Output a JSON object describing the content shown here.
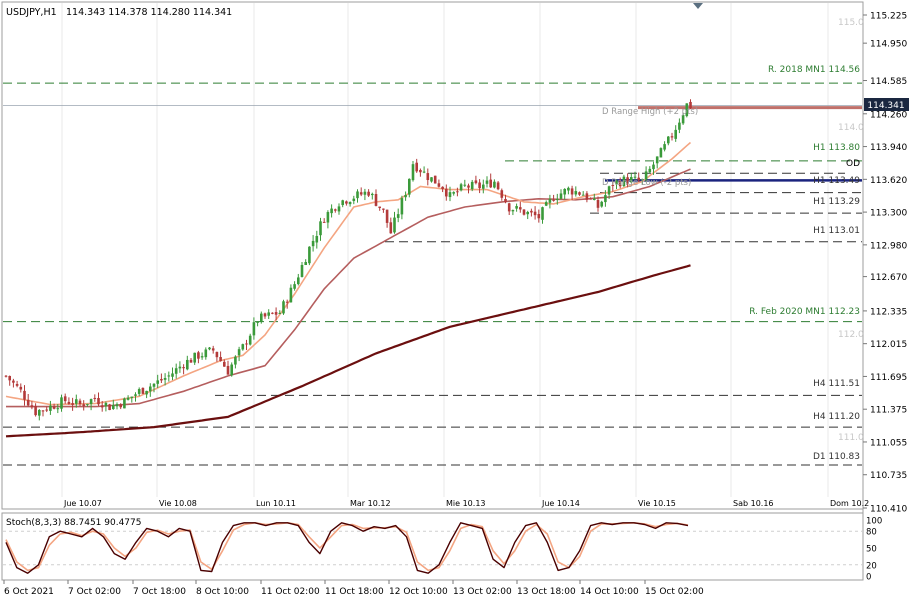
{
  "header": {
    "symbol": "USDJPY,H1",
    "ohlc": "114.343 114.378 114.280 114.341"
  },
  "price_tag": "114.341",
  "stoch_label": "Stoch(8,3,3) 88.7451 90.4775",
  "annotations": {
    "r2018": "R. 2018 MN1 114.56",
    "h1_113_80": "H1 113.80",
    "od": "OD",
    "h1_113_49": "H1 113.49",
    "h1_113_29": "H1 113.29",
    "h1_113_01": "H1 113.01",
    "rfeb2020": "R. Feb 2020 MN1 112.23",
    "h4_111_51": "H4 111.51",
    "h4_111_20": "H4 111.20",
    "d1_110_83": "D1 110.83",
    "drange_high": "D Range High (+2 pts)",
    "drange_low": "D Range Low (-2 pts)",
    "wm_115": "115.0",
    "wm_114": "114.0",
    "wm_112": "112.0",
    "wm_111": "111.0"
  },
  "colors": {
    "ma_fast": "#f4a582",
    "ma_mid": "#b55e5e",
    "ma_slow": "#6b0f0f",
    "bull": "#3a9a3a",
    "bear": "#b33a3a",
    "stoch_main": "#4a0000",
    "stoch_signal": "#f4a582",
    "level_green": "#2e7d32",
    "level_blue": "#1a237e",
    "level_red": "#c0706a"
  },
  "chart_data": {
    "type": "candlestick",
    "y_ticks": [
      "115.225",
      "114.950",
      "114.585",
      "114.260",
      "113.940",
      "113.620",
      "113.300",
      "112.980",
      "112.670",
      "112.335",
      "112.015",
      "111.695",
      "111.375",
      "111.055",
      "110.735",
      "110.410"
    ],
    "x_ticks_top": [
      "Jue 10.07",
      "Vie 10.08",
      "Lun 10.11",
      "Mar 10.12",
      "Mie 10.13",
      "Jue 10.14",
      "Vie 10.15",
      "Sab 10.16",
      "Dom 10.2"
    ],
    "x_ticks_bottom": [
      "6 Oct 2021",
      "7 Oct 02:00",
      "7 Oct 18:00",
      "8 Oct 10:00",
      "11 Oct 02:00",
      "11 Oct 18:00",
      "12 Oct 10:00",
      "13 Oct 02:00",
      "13 Oct 18:00",
      "14 Oct 10:00",
      "15 Oct 02:00"
    ],
    "stoch_ticks": [
      "100",
      "80",
      "50",
      "20",
      "0"
    ],
    "close_path": [
      [
        0,
        111.7
      ],
      [
        4,
        111.55
      ],
      [
        8,
        111.35
      ],
      [
        12,
        111.4
      ],
      [
        16,
        111.46
      ],
      [
        20,
        111.42
      ],
      [
        24,
        111.48
      ],
      [
        28,
        111.4
      ],
      [
        32,
        111.45
      ],
      [
        36,
        111.55
      ],
      [
        40,
        111.62
      ],
      [
        44,
        111.7
      ],
      [
        48,
        111.82
      ],
      [
        52,
        111.9
      ],
      [
        56,
        111.95
      ],
      [
        60,
        111.75
      ],
      [
        64,
        111.98
      ],
      [
        68,
        112.25
      ],
      [
        72,
        112.3
      ],
      [
        74,
        112.32
      ],
      [
        78,
        112.6
      ],
      [
        82,
        112.95
      ],
      [
        86,
        113.25
      ],
      [
        90,
        113.4
      ],
      [
        94,
        113.45
      ],
      [
        98,
        113.5
      ],
      [
        102,
        113.3
      ],
      [
        104,
        113.1
      ],
      [
        108,
        113.5
      ],
      [
        110,
        113.78
      ],
      [
        114,
        113.65
      ],
      [
        118,
        113.55
      ],
      [
        120,
        113.45
      ],
      [
        124,
        113.55
      ],
      [
        128,
        113.55
      ],
      [
        132,
        113.6
      ],
      [
        136,
        113.35
      ],
      [
        140,
        113.3
      ],
      [
        144,
        113.25
      ],
      [
        148,
        113.45
      ],
      [
        152,
        113.52
      ],
      [
        156,
        113.48
      ],
      [
        160,
        113.35
      ],
      [
        164,
        113.58
      ],
      [
        168,
        113.62
      ],
      [
        172,
        113.6
      ],
      [
        176,
        113.82
      ],
      [
        180,
        114.05
      ],
      [
        184,
        114.35
      ],
      [
        185,
        114.34
      ]
    ],
    "ma_fast_path": [
      [
        0,
        111.5
      ],
      [
        12,
        111.42
      ],
      [
        24,
        111.43
      ],
      [
        36,
        111.5
      ],
      [
        48,
        111.7
      ],
      [
        58,
        111.85
      ],
      [
        64,
        111.9
      ],
      [
        70,
        112.1
      ],
      [
        78,
        112.5
      ],
      [
        86,
        112.95
      ],
      [
        94,
        113.35
      ],
      [
        100,
        113.4
      ],
      [
        106,
        113.42
      ],
      [
        112,
        113.55
      ],
      [
        120,
        113.52
      ],
      [
        130,
        113.52
      ],
      [
        140,
        113.4
      ],
      [
        148,
        113.38
      ],
      [
        156,
        113.45
      ],
      [
        164,
        113.5
      ],
      [
        172,
        113.6
      ],
      [
        180,
        113.82
      ],
      [
        185,
        113.98
      ]
    ],
    "ma_mid_path": [
      [
        0,
        111.4
      ],
      [
        12,
        111.4
      ],
      [
        24,
        111.4
      ],
      [
        36,
        111.43
      ],
      [
        48,
        111.55
      ],
      [
        60,
        111.7
      ],
      [
        70,
        111.8
      ],
      [
        78,
        112.15
      ],
      [
        86,
        112.55
      ],
      [
        94,
        112.85
      ],
      [
        104,
        113.05
      ],
      [
        114,
        113.25
      ],
      [
        124,
        113.35
      ],
      [
        134,
        113.4
      ],
      [
        144,
        113.43
      ],
      [
        154,
        113.42
      ],
      [
        164,
        113.45
      ],
      [
        174,
        113.55
      ],
      [
        185,
        113.72
      ]
    ],
    "ma_slow_path": [
      [
        0,
        111.11
      ],
      [
        20,
        111.15
      ],
      [
        40,
        111.2
      ],
      [
        60,
        111.3
      ],
      [
        80,
        111.6
      ],
      [
        100,
        111.92
      ],
      [
        120,
        112.18
      ],
      [
        140,
        112.35
      ],
      [
        160,
        112.52
      ],
      [
        175,
        112.68
      ],
      [
        185,
        112.78
      ]
    ],
    "levels": [
      {
        "price": 114.56,
        "style": "green-dash",
        "label": "r2018"
      },
      {
        "price": 113.8,
        "style": "green-dash",
        "label": "h1_113_80"
      },
      {
        "price": 113.49,
        "style": "dark-dash",
        "label": "h1_113_49"
      },
      {
        "price": 113.29,
        "style": "dark-dash",
        "label": "h1_113_29"
      },
      {
        "price": 113.01,
        "style": "dark-dash",
        "label": "h1_113_01"
      },
      {
        "price": 112.23,
        "style": "green-dash",
        "label": "rfeb2020"
      },
      {
        "price": 111.51,
        "style": "dark-dash",
        "label": "h4_111_51"
      },
      {
        "price": 111.2,
        "style": "dark-dash",
        "label": "h4_111_20"
      },
      {
        "price": 110.83,
        "style": "dark-dash",
        "label": "d1_110_83"
      }
    ],
    "current_price": 114.341,
    "drange_high": 114.32,
    "drange_low": 113.61,
    "stoch_main": [
      60,
      15,
      5,
      20,
      70,
      80,
      75,
      70,
      85,
      70,
      40,
      30,
      60,
      85,
      80,
      70,
      85,
      80,
      10,
      8,
      60,
      90,
      95,
      95,
      90,
      95,
      95,
      90,
      60,
      40,
      80,
      95,
      90,
      80,
      88,
      85,
      90,
      70,
      10,
      5,
      20,
      60,
      95,
      90,
      85,
      30,
      15,
      60,
      90,
      95,
      60,
      10,
      15,
      45,
      90,
      95,
      92,
      95,
      95,
      92,
      85,
      95,
      94,
      90
    ],
    "stoch_signal": [
      65,
      25,
      10,
      15,
      55,
      75,
      78,
      72,
      80,
      75,
      50,
      35,
      50,
      78,
      82,
      75,
      80,
      82,
      25,
      12,
      45,
      82,
      92,
      95,
      92,
      93,
      95,
      92,
      70,
      50,
      70,
      90,
      92,
      85,
      86,
      86,
      88,
      78,
      25,
      10,
      15,
      45,
      85,
      92,
      88,
      45,
      22,
      45,
      80,
      92,
      75,
      25,
      15,
      35,
      80,
      93,
      93,
      94,
      95,
      93,
      88,
      92,
      94,
      91
    ]
  }
}
